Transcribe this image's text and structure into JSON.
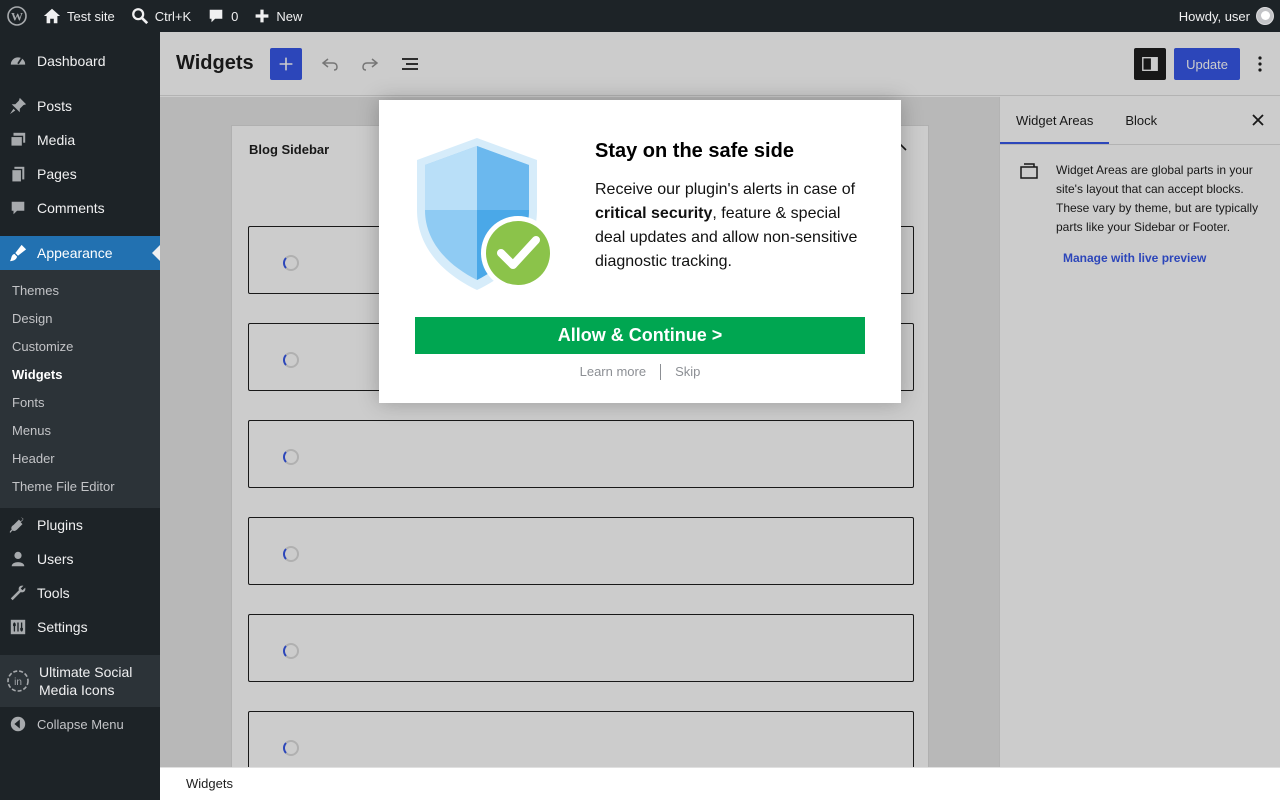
{
  "adminbar": {
    "site_name": "Test site",
    "search_shortcut": "Ctrl+K",
    "comments_count": "0",
    "new_label": "New",
    "howdy": "Howdy, user"
  },
  "menu": {
    "dashboard": "Dashboard",
    "posts": "Posts",
    "media": "Media",
    "pages": "Pages",
    "comments": "Comments",
    "appearance": "Appearance",
    "submenu": [
      "Themes",
      "Design",
      "Customize",
      "Widgets",
      "Fonts",
      "Menus",
      "Header",
      "Theme File Editor"
    ],
    "plugins": "Plugins",
    "users": "Users",
    "tools": "Tools",
    "settings": "Settings",
    "usmi": "Ultimate Social Media Icons",
    "collapse": "Collapse Menu"
  },
  "editor": {
    "title": "Widgets",
    "update_label": "Update",
    "area_title": "Blog Sidebar",
    "footer_breadcrumb": "Widgets"
  },
  "inspector": {
    "tab_areas": "Widget Areas",
    "tab_block": "Block",
    "description": "Widget Areas are global parts in your site's layout that can accept blocks. These vary by theme, but are typically parts like your Sidebar or Footer.",
    "link": "Manage with live preview"
  },
  "modal": {
    "title": "Stay on the safe side",
    "text_before": "Receive our plugin's alerts in case of ",
    "text_bold": "critical security",
    "text_after": ", feature & special deal updates and allow non-sensitive diagnostic tracking.",
    "button": "Allow & Continue >",
    "learn_more": "Learn more",
    "skip": "Skip"
  },
  "colors": {
    "accent": "#3858e9",
    "admin_blue": "#2271b1",
    "allow_green": "#00a651"
  }
}
